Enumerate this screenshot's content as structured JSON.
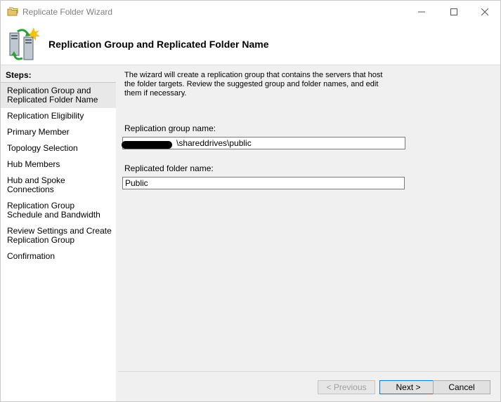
{
  "window": {
    "title": "Replicate Folder Wizard"
  },
  "header": {
    "title": "Replication Group and Replicated Folder Name"
  },
  "steps": {
    "heading": "Steps:",
    "items": [
      {
        "label": "Replication Group and Replicated Folder Name",
        "active": true
      },
      {
        "label": "Replication Eligibility"
      },
      {
        "label": "Primary Member"
      },
      {
        "label": "Topology Selection"
      },
      {
        "label": "Hub Members"
      },
      {
        "label": "Hub and Spoke Connections"
      },
      {
        "label": "Replication Group Schedule and Bandwidth"
      },
      {
        "label": "Review Settings and Create Replication Group"
      },
      {
        "label": "Confirmation"
      }
    ]
  },
  "main": {
    "description": "The wizard will create a replication group that contains the servers that host the folder targets. Review the suggested group and folder names, and edit them if necessary.",
    "group_label": "Replication group name:",
    "group_value": "\\shareddrives\\public",
    "folder_label": "Replicated folder name:",
    "folder_value": "Public"
  },
  "buttons": {
    "previous": "< Previous",
    "next": "Next >",
    "cancel": "Cancel"
  },
  "icons": {
    "title_icon": "folder-replicate-icon",
    "header_icon": "replication-servers-icon",
    "minimize": "minimize-icon",
    "maximize": "maximize-icon",
    "close": "close-icon"
  },
  "colors": {
    "accent": "#0078d7",
    "disabled_text": "#a0a0a0"
  }
}
